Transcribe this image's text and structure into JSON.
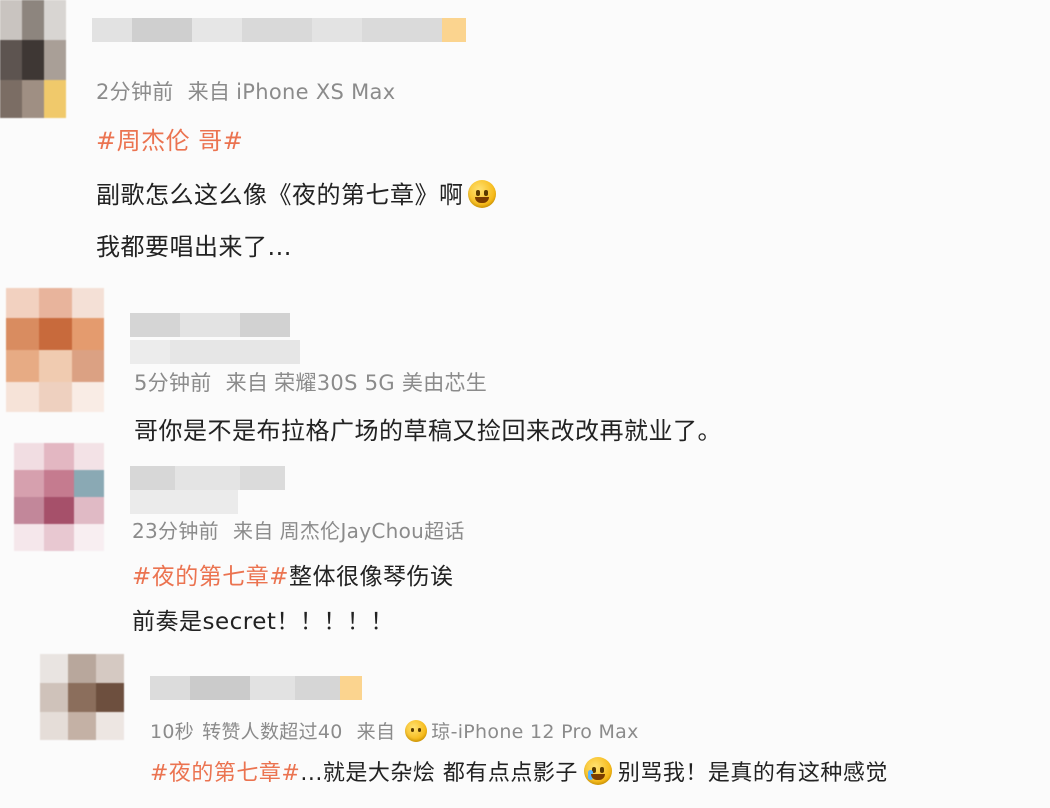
{
  "comments": [
    {
      "time": "2分钟前",
      "source_prefix": "来自",
      "source": "iPhone XS Max",
      "lines": [
        {
          "hashtag": "#周杰伦 哥#",
          "text": ""
        },
        {
          "hashtag": "",
          "text": "副歌怎么这么像《夜的第七章》啊",
          "emoji": "grin-sweat-icon"
        },
        {
          "hashtag": "",
          "text": "我都要唱出来了..."
        }
      ]
    },
    {
      "time": "5分钟前",
      "source_prefix": "来自",
      "source": "荣耀30S 5G 美由芯生",
      "lines": [
        {
          "hashtag": "",
          "text": "哥你是不是布拉格广场的草稿又捡回来改改再就业了。"
        }
      ]
    },
    {
      "time": "23分钟前",
      "source_prefix": "来自",
      "source": "周杰伦JayChou超话",
      "lines": [
        {
          "hashtag": "#夜的第七章#",
          "text": "整体很像琴伤诶"
        },
        {
          "hashtag": "",
          "text": "前奏是secret！！！！！"
        }
      ]
    },
    {
      "time": "10秒",
      "extra": "转赞人数超过40",
      "source_prefix": "来自",
      "source": "琼-iPhone 12 Pro Max",
      "source_emoji": "scream-icon",
      "lines": [
        {
          "hashtag": "#夜的第七章#",
          "text": "...就是大杂烩 都有点点影子",
          "emoji": "crying-icon",
          "text2": "别骂我！是真的有这种感觉"
        }
      ]
    }
  ]
}
